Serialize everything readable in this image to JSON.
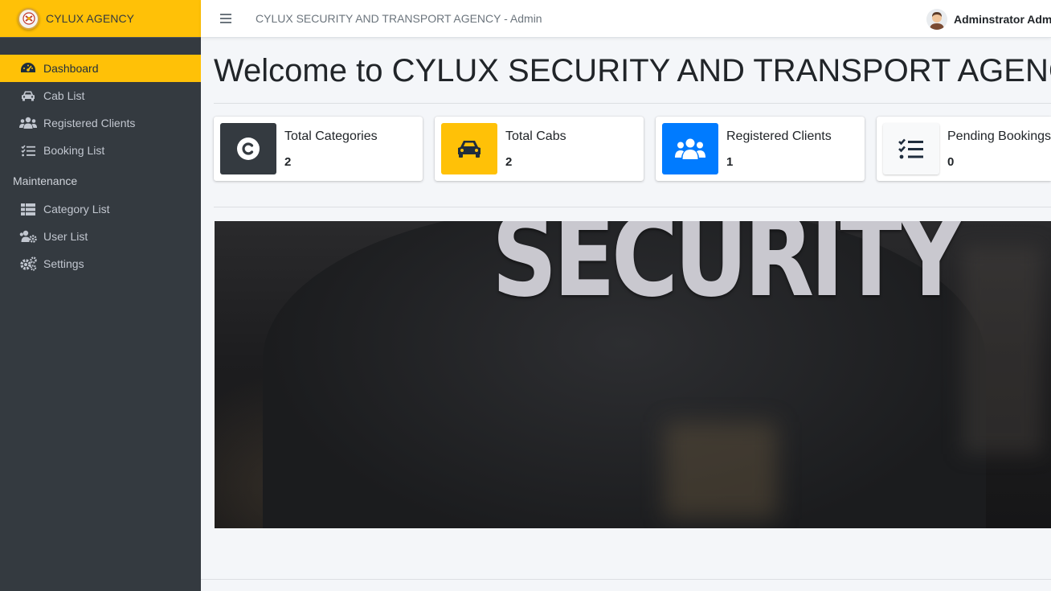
{
  "brand": {
    "name": "CYLUX AGENCY"
  },
  "topbar": {
    "title": "CYLUX SECURITY AND TRANSPORT AGENCY - Admin",
    "user_name": "Adminstrator Admin"
  },
  "sidebar": {
    "items": [
      {
        "label": "Dashboard",
        "icon": "dashboard-icon",
        "active": true
      },
      {
        "label": "Cab List",
        "icon": "car-icon"
      },
      {
        "label": "Registered Clients",
        "icon": "users-icon"
      },
      {
        "label": "Booking List",
        "icon": "tasks-icon"
      }
    ],
    "maintenance_header": "Maintenance",
    "maintenance_items": [
      {
        "label": "Category List",
        "icon": "table-icon"
      },
      {
        "label": "User List",
        "icon": "users-cog-icon"
      },
      {
        "label": "Settings",
        "icon": "cogs-icon"
      }
    ]
  },
  "main": {
    "welcome": "Welcome to CYLUX SECURITY AND TRANSPORT AGENCY",
    "info_boxes": [
      {
        "label": "Total Categories",
        "value": "2",
        "icon": "copyright-icon",
        "color": "#343a40"
      },
      {
        "label": "Total Cabs",
        "value": "2",
        "icon": "car-icon",
        "color": "#ffc107"
      },
      {
        "label": "Registered Clients",
        "value": "1",
        "icon": "users-icon",
        "color": "#007bff"
      },
      {
        "label": "Pending Bookings",
        "value": "0",
        "icon": "tasks-icon",
        "color": "#f8f9fa"
      }
    ],
    "banner_text": "SECURITY"
  },
  "colors": {
    "sidebar": "#343a40",
    "accent": "#ffc107",
    "primary": "#007bff"
  }
}
